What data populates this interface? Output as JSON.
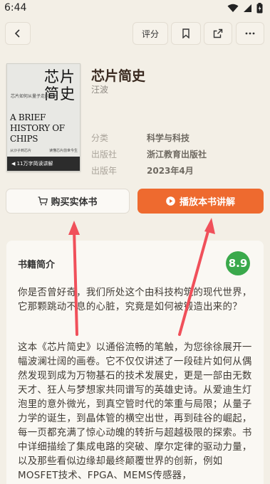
{
  "status_bar": {
    "time": "6:44"
  },
  "toolbar": {
    "rate_label": "评分"
  },
  "book": {
    "title": "芯片简史",
    "author": "汪波",
    "meta": [
      {
        "key": "分类",
        "value": "科学与科技"
      },
      {
        "key": "出版社",
        "value": "浙江教育出版社"
      },
      {
        "key": "出版年",
        "value": "2023年4月"
      }
    ],
    "cover": {
      "title_line1": "芯片",
      "title_line2": "简史",
      "subtitle": "芯片如何从量子走向世界",
      "en_title": "A BRIEF HISTORY OF CHIPS",
      "author": "汪 波 著",
      "footer_left": "从沙子到芯片",
      "footer_right": "读懂芯片前世今生",
      "banner": "◀ 11万字简读讲解"
    }
  },
  "actions": {
    "buy_physical": "购买实体书",
    "play_explanation": "播放本书讲解"
  },
  "intro": {
    "heading": "书籍简介",
    "score": "8.9",
    "paragraph1": "你是否曾好奇，我们所处这个由科技构筑的现代世界，它那颗跳动不息的心脏，究竟是如何被锻造出来的？",
    "paragraph2": "这本《芯片简史》以通俗流畅的笔触，为您徐徐展开一幅波澜壮阔的画卷。它不仅仅讲述了一段硅片如何从偶然发现到成为万物基石的技术发展史，更是一部由无数天才、狂人与梦想家共同谱写的英雄史诗。从爱迪生灯泡里的意外微光，到真空管时代的笨重与局限；从量子力学的诞生，到晶体管的横空出世，再到硅谷的崛起，每一页都充满了惊心动魄的转折与超越极限的探索。书中详细描绘了集成电路的突破、摩尔定律的驱动力量，以及那些看似边缘却最终颠覆世界的创新，例如MOSFET技术、FPGA、MEMS传感器，"
  },
  "colors": {
    "background": "#f3efe6",
    "accent_orange": "#ee6a2f",
    "score_green": "#3aa94b",
    "annotation_red": "#f0505a"
  }
}
